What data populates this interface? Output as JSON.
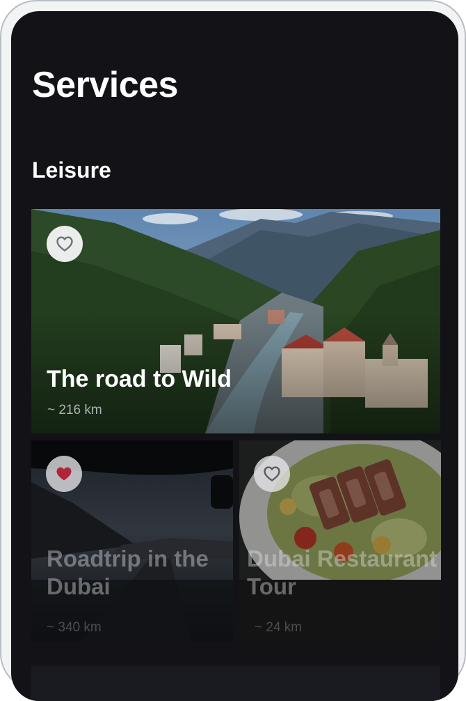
{
  "page": {
    "title": "Services",
    "section": "Leisure"
  },
  "cards": [
    {
      "title": "The road to Wild",
      "distance": "~ 216 km",
      "favorited": false,
      "icon": "heart-outline-icon"
    },
    {
      "title": "Roadtrip in the Dubai",
      "distance": "~ 340 km",
      "favorited": true,
      "icon": "heart-filled-icon"
    },
    {
      "title": "Dubai Restaurant Tour",
      "distance": "~ 24 km",
      "favorited": false,
      "icon": "heart-outline-icon"
    }
  ],
  "colors": {
    "background": "#131317",
    "text": "#ffffff",
    "favorite": "#b0243a"
  }
}
